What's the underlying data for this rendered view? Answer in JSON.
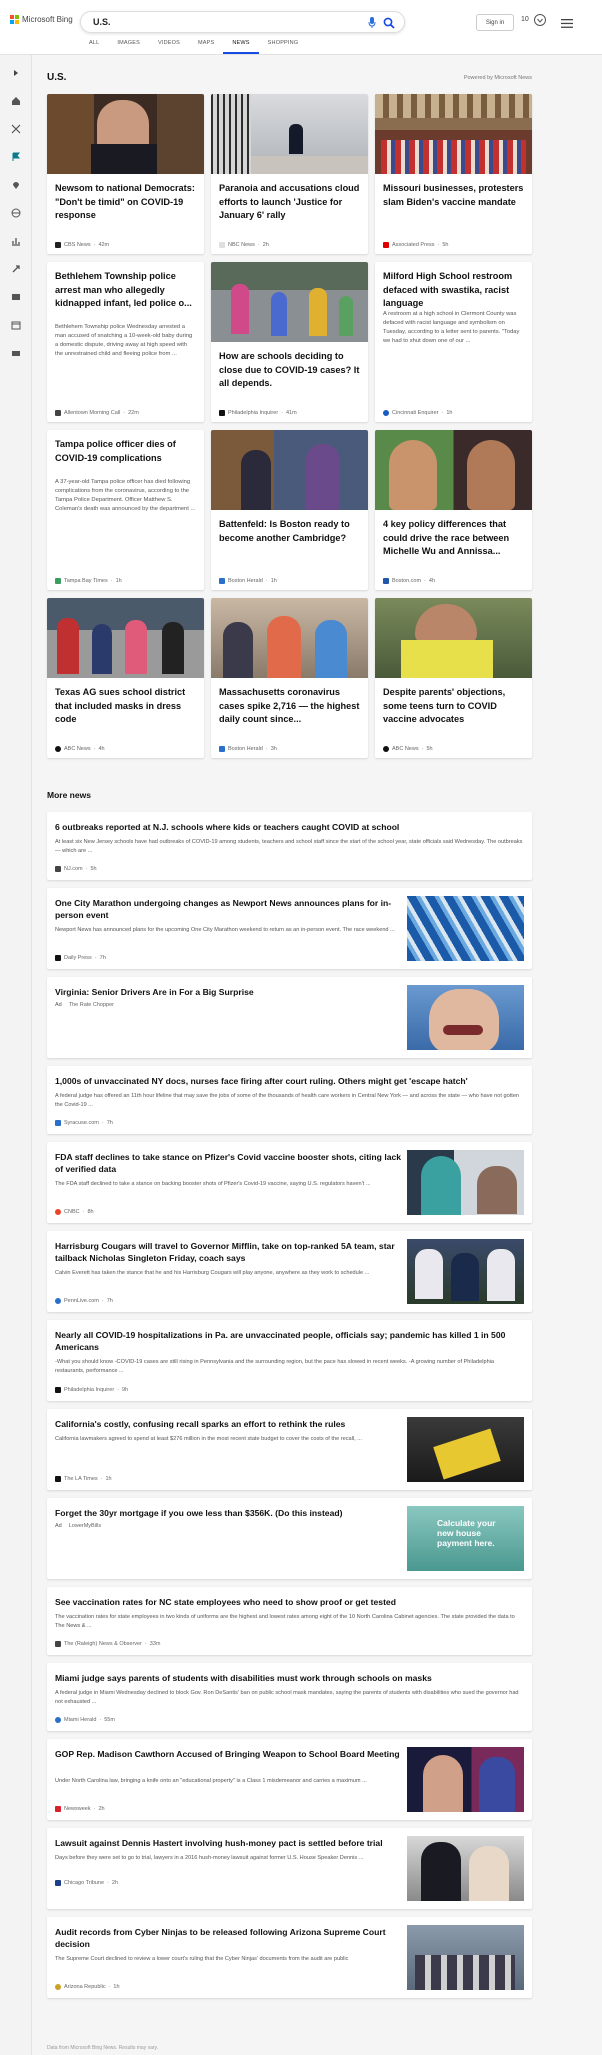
{
  "header": {
    "logo_text": "Microsoft Bing",
    "search_query": "U.S.",
    "signin": "Sign in",
    "points": "10"
  },
  "tabs": [
    "ALL",
    "IMAGES",
    "VIDEOS",
    "MAPS",
    "NEWS",
    "SHOPPING"
  ],
  "active_tab": "NEWS",
  "section": {
    "title": "U.S.",
    "powered": "Powered by Microsoft News"
  },
  "cards": [
    {
      "title": "Newsom to national Democrats: \"Don't be timid\" on COVID-19 response",
      "source": "CBS News",
      "time": "42m",
      "favicon": "#222"
    },
    {
      "title": "Paranoia and accusations cloud efforts to launch 'Justice for January 6' rally",
      "source": "NBC News",
      "time": "2h",
      "favicon": "#fff"
    },
    {
      "title": "Missouri businesses, protesters slam Biden's vaccine mandate",
      "source": "Associated Press",
      "time": "5h",
      "favicon": "#d00"
    },
    {
      "title": "Bethlehem Township police arrest man who allegedly kidnapped infant, led police o...",
      "snippet": "Bethlehem Township police Wednesday arrested a man accused of snatching a 10-week-old baby during a domestic dispute, driving away at high speed with the unrestrained child and fleeing police from ...",
      "source": "Allentown Morning Call",
      "time": "22m",
      "favicon": "#444"
    },
    {
      "title": "How are schools deciding to close due to COVID-19 cases? It all depends.",
      "source": "Philadelphia Inquirer",
      "time": "41m",
      "favicon": "#111"
    },
    {
      "title": "Milford High School restroom defaced with swastika, racist language",
      "snippet": "A restroom at a high school in Clermont County was defaced with racist language and symbolism on Tuesday, according to a letter sent to parents. \"Today we had to shut down one of our ...",
      "source": "Cincinnati Enquirer",
      "time": "1h",
      "favicon": "#1a5bbf"
    },
    {
      "title": "Tampa police officer dies of COVID-19 complications",
      "snippet": "A 37-year-old Tampa police officer has died following complications from the coronavirus, according to the Tampa Police Department. Officer Matthew S. Coleman's death was announced by the department ...",
      "source": "Tampa Bay Times",
      "time": "1h",
      "favicon": "#3a9e5f"
    },
    {
      "title": "Battenfeld: Is Boston ready to become another Cambridge?",
      "source": "Boston Herald",
      "time": "1h",
      "favicon": "#2a6fc9"
    },
    {
      "title": "4 key policy differences that could drive the race between Michelle Wu and Annissa...",
      "source": "Boston.com",
      "time": "4h",
      "favicon": "#2156a8"
    },
    {
      "title": "Texas AG sues school district that included masks in dress code",
      "source": "ABC News",
      "time": "4h",
      "favicon": "#111"
    },
    {
      "title": "Massachusetts coronavirus cases spike 2,716 — the highest daily count since...",
      "source": "Boston Herald",
      "time": "3h",
      "favicon": "#2a6fc9"
    },
    {
      "title": "Despite parents' objections, some teens turn to COVID vaccine advocates",
      "source": "ABC News",
      "time": "5h",
      "favicon": "#111"
    }
  ],
  "more_news_title": "More news",
  "rows": [
    {
      "title": "6 outbreaks reported at N.J. schools where kids or teachers caught COVID at school",
      "snippet": "At least six New Jersey schools have had outbreaks of COVID-19 among students, teachers and school staff since the start of the school year, state officials said Wednesday. The outbreaks — which are ...",
      "source": "NJ.com",
      "time": "5h",
      "favicon": "#444"
    },
    {
      "title": "One City Marathon undergoing changes as Newport News announces plans for in-person event",
      "snippet": "Newport News has announced plans for the upcoming One City Marathon weekend to return as an in-person event. The race weekend ...",
      "source": "Daily Press",
      "time": "7h",
      "favicon": "#111"
    },
    {
      "title": "Virginia: Senior Drivers Are in For a Big Surprise",
      "ad": "Ad",
      "source": "The Rate Chopper"
    },
    {
      "title": "1,000s of unvaccinated NY docs, nurses face firing after court ruling. Others might get 'escape hatch'",
      "snippet": "A federal judge has offered an 11th hour lifeline that may save the jobs of some of the thousands of health care workers in Central New York — and across the state — who have not gotten the Covid-19 ...",
      "source": "Syracuse.com",
      "time": "7h",
      "favicon": "#2a6fc9"
    },
    {
      "title": "FDA staff declines to take stance on Pfizer's Covid vaccine booster shots, citing lack of verified data",
      "snippet": "The FDA staff declined to take a stance on backing booster shots of Pfizer's Covid-19 vaccine, saying U.S. regulators haven't ...",
      "source": "CNBC",
      "time": "8h",
      "favicon": "#e8442a"
    },
    {
      "title": "Harrisburg Cougars will travel to Governor Mifflin, take on top-ranked 5A team, star tailback Nicholas Singleton Friday, coach says",
      "snippet": "Calvin Everett has taken the stance that he and his Harrisburg Cougars will play anyone, anywhere as they work to schedule ...",
      "source": "PennLive.com",
      "time": "7h",
      "favicon": "#2a6fc9"
    },
    {
      "title": "Nearly all COVID-19 hospitalizations in Pa. are unvaccinated people, officials say; pandemic has killed 1 in 500 Americans",
      "snippet": "-What you should know -COVID-19 cases are still rising in Pennsylvania and the surrounding region, but the pace has slowed in recent weeks. -A growing number of Philadelphia restaurants, performance ...",
      "source": "Philadelphia Inquirer",
      "time": "9h",
      "favicon": "#111"
    },
    {
      "title": "California's costly, confusing recall sparks an effort to rethink the rules",
      "snippet": "California lawmakers agreed to spend at least $276 million in the most recent state budget to cover the costs of the recall, ...",
      "source": "The LA Times",
      "time": "1h",
      "favicon": "#111"
    },
    {
      "title": "Forget the 30yr mortgage if you owe less than $356K. (Do this instead)",
      "ad": "Ad",
      "source": "LowerMyBills",
      "img_text": "Calculate your new house payment here."
    },
    {
      "title": "See vaccination rates for NC state employees who need to show proof or get tested",
      "snippet": "The vaccination rates for state employees in two kinds of uniforms are the highest and lowest rates among eight of the 10 North Carolina Cabinet agencies. The state provided the data to The News & ...",
      "source": "The (Raleigh) News & Observer",
      "time": "33m",
      "favicon": "#444"
    },
    {
      "title": "Miami judge says parents of students with disabilities must work through schools on masks",
      "snippet": "A federal judge in Miami Wednesday declined to block Gov. Ron DeSantis' ban on public school mask mandates, saying the parents of students with disabilities who sued the governor had not exhausted ...",
      "source": "Miami Herald",
      "time": "55m",
      "favicon": "#2a6fc9"
    },
    {
      "title": "GOP Rep. Madison Cawthorn Accused of Bringing Weapon to School Board Meeting",
      "snippet": "Under North Carolina law, bringing a knife onto an \"educational property\" is a Class 1 misdemeanor and carries a maximum ...",
      "source": "Newsweek",
      "time": "2h",
      "favicon": "#d8202a"
    },
    {
      "title": "Lawsuit against Dennis Hastert involving hush-money pact is settled before trial",
      "snippet": "Days before they were set to go to trial, lawyers in a 2016 hush-money lawsuit against former U.S. House Speaker Dennis ...",
      "source": "Chicago Tribune",
      "time": "2h",
      "favicon": "#1c3f8c"
    },
    {
      "title": "Audit records from Cyber Ninjas to be released following Arizona Supreme Court decision",
      "snippet": "The Supreme Court declined to review a lower court's ruling that the Cyber Ninjas' documents from the audit are public",
      "source": "Arizona Republic",
      "time": "1h",
      "favicon": "#c9a227"
    }
  ],
  "footer": "Data from Microsoft Bing News. Results may vary."
}
